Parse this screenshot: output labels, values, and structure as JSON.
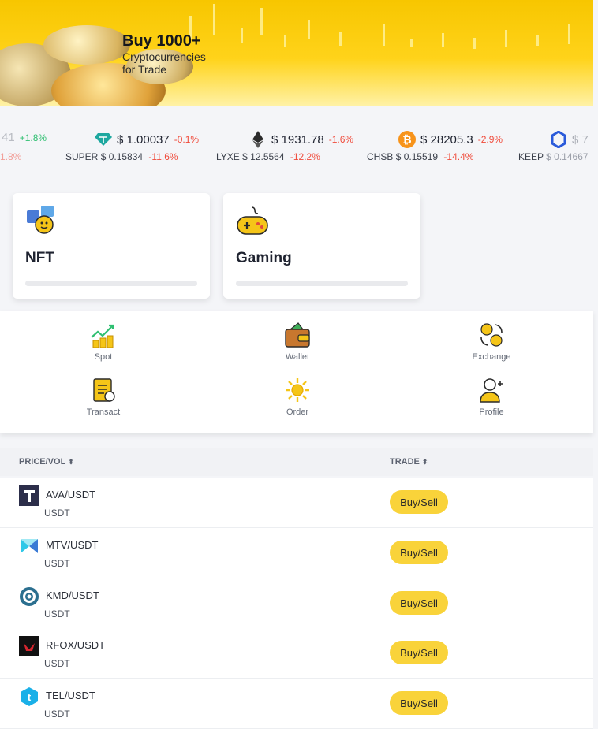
{
  "banner": {
    "title": "Buy 1000+",
    "subtitle_line1": "Cryptocurrencies",
    "subtitle_line2": "for Trade"
  },
  "ticker": {
    "items": [
      {
        "icon": "partial-coin-icon",
        "price": "41",
        "change": "+1.8%",
        "change_dir": "up",
        "sub_name": "",
        "sub_price": "",
        "sub_change": "1.8%"
      },
      {
        "icon": "diamond-icon",
        "price": "$ 1.00037",
        "change": "-0.1%",
        "change_dir": "down",
        "sub_name": "SUPER",
        "sub_price": "$ 0.15834",
        "sub_change": "-11.6%"
      },
      {
        "icon": "ethereum-icon",
        "price": "$ 1931.78",
        "change": "-1.6%",
        "change_dir": "down",
        "sub_name": "LYXE",
        "sub_price": "$ 12.5564",
        "sub_change": "-12.2%"
      },
      {
        "icon": "bitcoin-icon",
        "price": "$ 28205.3",
        "change": "-2.9%",
        "change_dir": "down",
        "sub_name": "CHSB",
        "sub_price": "$ 0.15519",
        "sub_change": "-14.4%"
      },
      {
        "icon": "chainlink-icon",
        "price": "$ 7",
        "change": "",
        "change_dir": "down",
        "sub_name": "KEEP",
        "sub_price": "$ 0.14667",
        "sub_change": ""
      }
    ]
  },
  "categories": [
    {
      "label": "NFT",
      "icon": "nft-icon"
    },
    {
      "label": "Gaming",
      "icon": "gamepad-icon"
    }
  ],
  "quick_menu": [
    {
      "label": "Spot",
      "icon": "spot-chart-icon"
    },
    {
      "label": "Wallet",
      "icon": "wallet-icon"
    },
    {
      "label": "Exchange",
      "icon": "exchange-icon"
    },
    {
      "label": "Transact",
      "icon": "transact-icon"
    },
    {
      "label": "Order",
      "icon": "order-icon"
    },
    {
      "label": "Profile",
      "icon": "profile-icon"
    }
  ],
  "table": {
    "col_price": "PRICE/VOL",
    "col_trade": "TRADE",
    "sort_glyph": "⬍",
    "rows": [
      {
        "pair": "AVA/USDT",
        "quote": "USDT",
        "action": "Buy/Sell",
        "icon": "ava-icon"
      },
      {
        "pair": "MTV/USDT",
        "quote": "USDT",
        "action": "Buy/Sell",
        "icon": "mtv-icon"
      },
      {
        "pair": "KMD/USDT",
        "quote": "USDT",
        "action": "Buy/Sell",
        "icon": "kmd-icon"
      },
      {
        "pair": "RFOX/USDT",
        "quote": "USDT",
        "action": "Buy/Sell",
        "icon": "rfox-icon"
      },
      {
        "pair": "TEL/USDT",
        "quote": "USDT",
        "action": "Buy/Sell",
        "icon": "tel-icon"
      }
    ]
  },
  "colors": {
    "accent": "#f9d33a",
    "positive": "#2fbf71",
    "negative": "#f04a3a"
  }
}
